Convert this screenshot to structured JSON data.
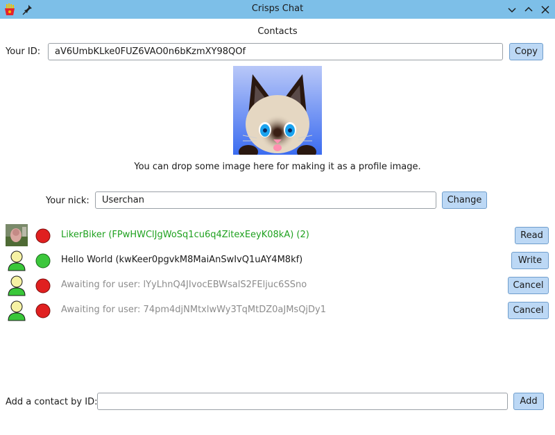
{
  "window": {
    "title": "Crisps Chat",
    "app_icon": "fries-icon",
    "pin_icon": "pin-icon",
    "controls": [
      "minimize-icon",
      "maximize-icon",
      "close-icon"
    ]
  },
  "contacts": {
    "section_title": "Contacts",
    "id_label": "Your ID:",
    "id_value": "aV6UmbKLke0FUZ6VAO0n6bKzmXY98QOf",
    "copy_label": "Copy",
    "drop_hint": "You can drop some image here for making it as a profile image.",
    "nick_label": "Your nick:",
    "nick_value": "Userchan",
    "change_label": "Change"
  },
  "contact_list": [
    {
      "text": "LikerBiker (FPwHWClJgWoSq1cu6q4ZitexEeyK08kA) (2)",
      "status": "offline",
      "button": "Read",
      "avatar": "photo"
    },
    {
      "text": "Hello World (kwKeer0pgvkM8MaiAnSwIvQ1uAY4M8kf)",
      "status": "online",
      "button": "Write",
      "avatar": "user-icon"
    },
    {
      "text": "Awaiting for user: lYyLhnQ4JIvocEBWsalS2FEljuc6SSno",
      "status": "offline",
      "button": "Cancel",
      "avatar": "user-icon"
    },
    {
      "text": "Awaiting for user: 74pm4djNMtxlwWy3TqMtDZ0aJMsQjDy1",
      "status": "offline",
      "button": "Cancel",
      "avatar": "user-icon"
    }
  ],
  "add_contact": {
    "label": "Add a contact by ID:",
    "value": "",
    "button": "Add"
  },
  "colors": {
    "titlebar": "#7dbfe8",
    "button": "#bcd8f5",
    "online": "#3cc73c",
    "offline": "#e02020",
    "unread_text": "#1fa11f",
    "pending_text": "#8c8c8c"
  }
}
